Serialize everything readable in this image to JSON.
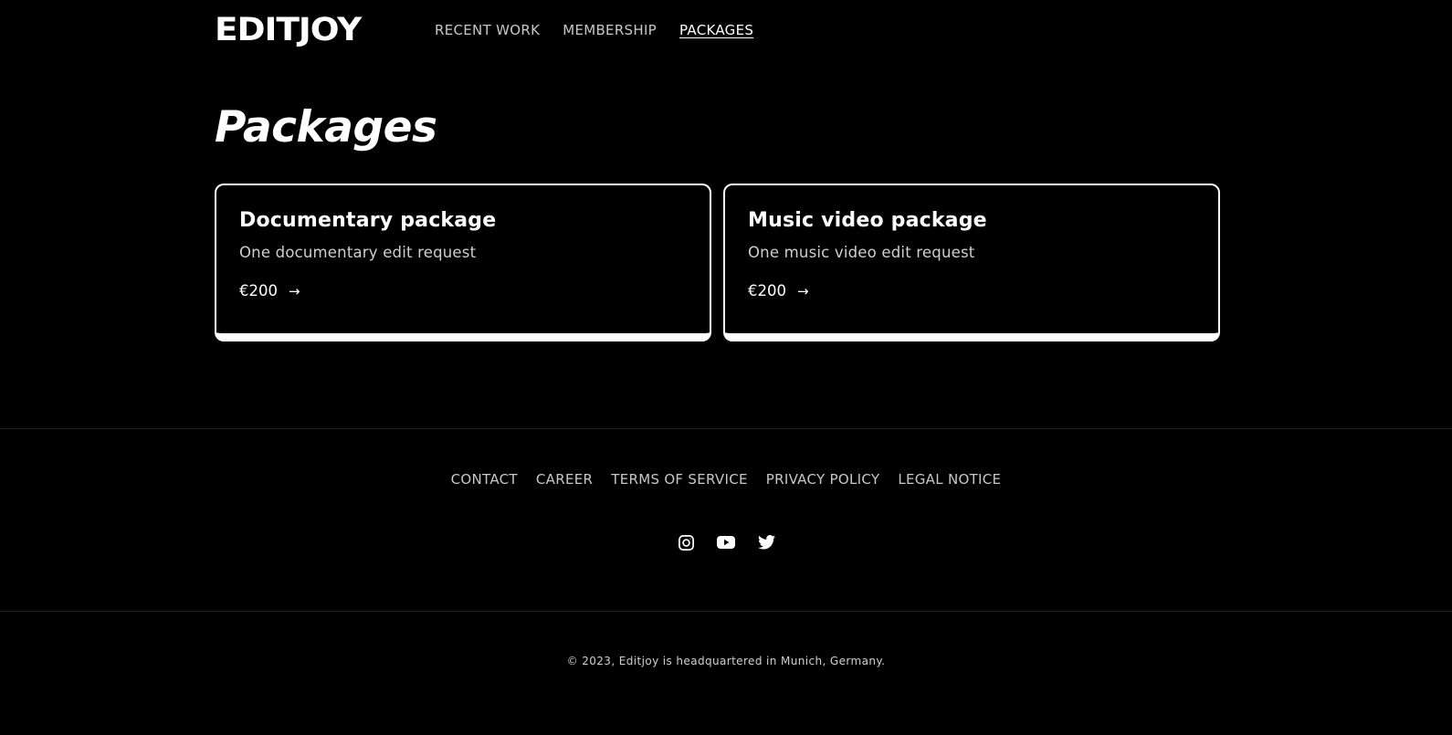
{
  "header": {
    "logo": "EDITJOY",
    "nav": [
      {
        "label": "RECENT WORK"
      },
      {
        "label": "MEMBERSHIP"
      },
      {
        "label": "PACKAGES",
        "active": true
      }
    ]
  },
  "main": {
    "title": "Packages",
    "cards": [
      {
        "title": "Documentary package",
        "description": "One documentary edit request",
        "price": "€200"
      },
      {
        "title": "Music video package",
        "description": "One music video edit request",
        "price": "€200"
      }
    ]
  },
  "footer": {
    "links": [
      "CONTACT",
      "CAREER",
      "TERMS OF SERVICE",
      "PRIVACY POLICY",
      "LEGAL NOTICE"
    ],
    "social_icons": [
      "instagram-icon",
      "youtube-icon",
      "twitter-icon"
    ],
    "copyright": "© 2023, Editjoy is headquartered in Munich, Germany."
  },
  "colors": {
    "background": "#000000",
    "text": "#ffffff",
    "muted": "#c7c7c7"
  }
}
